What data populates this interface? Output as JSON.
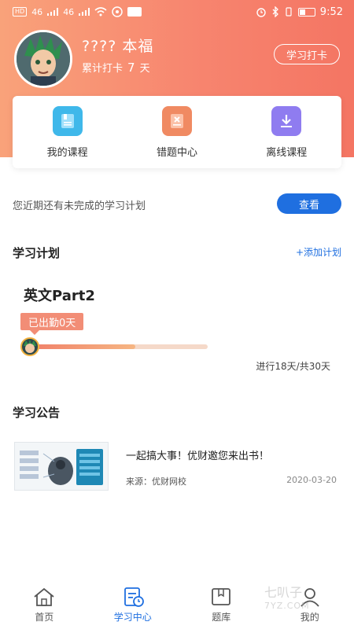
{
  "status_bar": {
    "left_labels": [
      "HD",
      "46",
      "46"
    ],
    "time": "9:52"
  },
  "profile": {
    "name": "???? 本福",
    "checkin_label": "累计打卡",
    "checkin_days": "7",
    "checkin_unit": "天",
    "checkin_button": "学习打卡"
  },
  "quick_links": [
    {
      "label": "我的课程",
      "icon": "course-book-icon",
      "color": "#3fb8ea"
    },
    {
      "label": "错题中心",
      "icon": "wrong-questions-icon",
      "color": "#f08a62"
    },
    {
      "label": "离线课程",
      "icon": "download-icon",
      "color": "#8f7cf0"
    }
  ],
  "plan_notice": {
    "text": "您近期还有未完成的学习计划",
    "button": "查看"
  },
  "study_plan": {
    "title": "学习计划",
    "add_link": "+添加计划",
    "course_title": "英文Part2",
    "attendance": "已出勤0天",
    "progress_text": "进行18天/共30天",
    "progress_fraction": 0.6
  },
  "announcement": {
    "title": "学习公告",
    "item_title": "一起搞大事！优财邀您来出书！",
    "source": "来源：优财网校",
    "date": "2020-03-20"
  },
  "bottom_nav": [
    {
      "label": "首页",
      "icon": "home-icon",
      "active": false
    },
    {
      "label": "学习中心",
      "icon": "study-center-icon",
      "active": true
    },
    {
      "label": "题库",
      "icon": "question-bank-icon",
      "active": false
    },
    {
      "label": "我的",
      "icon": "profile-icon",
      "active": false
    }
  ],
  "watermark": {
    "text": "七叭子",
    "sub": "7YZ.COM"
  },
  "colors": {
    "accent": "#1f6fe0",
    "header_start": "#f9a27a",
    "header_end": "#f47563"
  }
}
